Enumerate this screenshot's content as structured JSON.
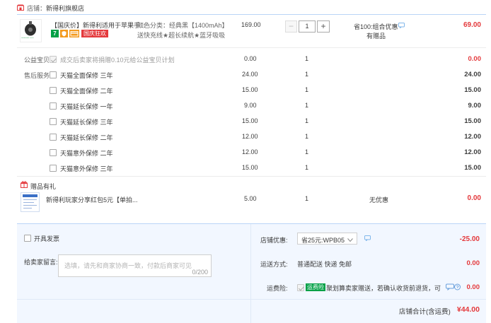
{
  "shop": {
    "prefix": "店铺：",
    "name": "新得利旗舰店"
  },
  "product": {
    "image_caption": "SHINEDEAL 新得利",
    "title": "【国庆价】新得利适用于苹果手...",
    "badges": {
      "seven_day": "7",
      "national_day": "国庆狂欢"
    },
    "spec_line1": "颜色分类：经典黑【1400mAh】",
    "spec_line2": "送快充线★超长续航★蓝牙吸吸",
    "price": "169.00",
    "qty": "1",
    "discount_line1": "省100:组合优惠",
    "discount_line2": "有赠品",
    "subtotal": "69.00"
  },
  "charity": {
    "label": "公益宝贝",
    "text": "成交后卖家将捐赠0.10元给公益宝贝计划",
    "price": "0.00",
    "qty": "1",
    "total": "0.00"
  },
  "after_sales": {
    "label": "售后服务",
    "items": [
      {
        "name": "天猫全面保修 三年",
        "price": "24.00",
        "qty": "1",
        "total": "24.00"
      },
      {
        "name": "天猫全面保修 二年",
        "price": "15.00",
        "qty": "1",
        "total": "15.00"
      },
      {
        "name": "天猫延长保修 一年",
        "price": "9.00",
        "qty": "1",
        "total": "9.00"
      },
      {
        "name": "天猫延长保修 三年",
        "price": "15.00",
        "qty": "1",
        "total": "15.00"
      },
      {
        "name": "天猫延长保修 二年",
        "price": "12.00",
        "qty": "1",
        "total": "12.00"
      },
      {
        "name": "天猫意外保修 二年",
        "price": "12.00",
        "qty": "1",
        "total": "12.00"
      },
      {
        "name": "天猫意外保修 三年",
        "price": "15.00",
        "qty": "1",
        "total": "15.00"
      }
    ]
  },
  "gift": {
    "header": "赠品有礼",
    "title": "新得利玩家分享红包5元【单拍...",
    "price": "5.00",
    "qty": "1",
    "discount": "无优惠",
    "total": "0.00"
  },
  "invoice": {
    "label": "开具发票"
  },
  "message": {
    "label": "给卖家留言:",
    "placeholder": "选填，请先和商家协商一致，付款后商家可见",
    "counter": "0/200"
  },
  "coupon": {
    "label": "店铺优惠:",
    "selected": "省25元:WPB05",
    "amount": "-25.00"
  },
  "shipping": {
    "label": "运送方式:",
    "method": "普通配送 快递 免邮",
    "amount": "0.00"
  },
  "insurance": {
    "label": "运费险:",
    "badge": "运费险",
    "text": "聚划算卖家赠送，若确认收货前退货，可获...",
    "amount": "0.00"
  },
  "total": {
    "label": "店铺合计(含运费)",
    "amount": "¥44.00"
  },
  "colors": {
    "accent_red": "#e4393c",
    "tmall_green": "#00a046",
    "section_bg": "#f2f7ff",
    "divider": "#b9d4f7"
  }
}
